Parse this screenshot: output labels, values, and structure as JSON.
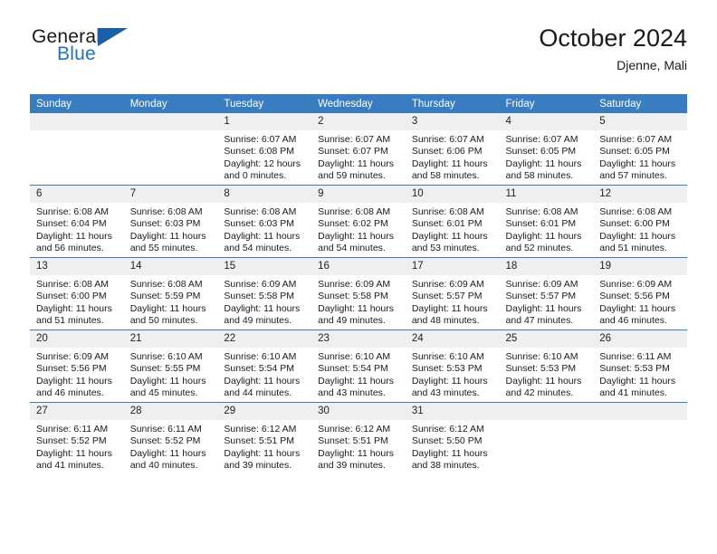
{
  "brand": {
    "name_part1": "General",
    "name_part2": "Blue",
    "mark": "triangle-logo"
  },
  "header": {
    "title": "October 2024",
    "location": "Djenne, Mali"
  },
  "weekday_headers": [
    "Sunday",
    "Monday",
    "Tuesday",
    "Wednesday",
    "Thursday",
    "Friday",
    "Saturday"
  ],
  "colors": {
    "header_blue": "#3a7cc0",
    "brand_blue": "#1b75bb",
    "daynum_band": "#efefef",
    "text": "#1a1a1a"
  },
  "weeks": [
    [
      {
        "day": "",
        "blank": true
      },
      {
        "day": "",
        "blank": true
      },
      {
        "day": "1",
        "sunrise": "Sunrise: 6:07 AM",
        "sunset": "Sunset: 6:08 PM",
        "daylight": "Daylight: 12 hours and 0 minutes."
      },
      {
        "day": "2",
        "sunrise": "Sunrise: 6:07 AM",
        "sunset": "Sunset: 6:07 PM",
        "daylight": "Daylight: 11 hours and 59 minutes."
      },
      {
        "day": "3",
        "sunrise": "Sunrise: 6:07 AM",
        "sunset": "Sunset: 6:06 PM",
        "daylight": "Daylight: 11 hours and 58 minutes."
      },
      {
        "day": "4",
        "sunrise": "Sunrise: 6:07 AM",
        "sunset": "Sunset: 6:05 PM",
        "daylight": "Daylight: 11 hours and 58 minutes."
      },
      {
        "day": "5",
        "sunrise": "Sunrise: 6:07 AM",
        "sunset": "Sunset: 6:05 PM",
        "daylight": "Daylight: 11 hours and 57 minutes."
      }
    ],
    [
      {
        "day": "6",
        "sunrise": "Sunrise: 6:08 AM",
        "sunset": "Sunset: 6:04 PM",
        "daylight": "Daylight: 11 hours and 56 minutes."
      },
      {
        "day": "7",
        "sunrise": "Sunrise: 6:08 AM",
        "sunset": "Sunset: 6:03 PM",
        "daylight": "Daylight: 11 hours and 55 minutes."
      },
      {
        "day": "8",
        "sunrise": "Sunrise: 6:08 AM",
        "sunset": "Sunset: 6:03 PM",
        "daylight": "Daylight: 11 hours and 54 minutes."
      },
      {
        "day": "9",
        "sunrise": "Sunrise: 6:08 AM",
        "sunset": "Sunset: 6:02 PM",
        "daylight": "Daylight: 11 hours and 54 minutes."
      },
      {
        "day": "10",
        "sunrise": "Sunrise: 6:08 AM",
        "sunset": "Sunset: 6:01 PM",
        "daylight": "Daylight: 11 hours and 53 minutes."
      },
      {
        "day": "11",
        "sunrise": "Sunrise: 6:08 AM",
        "sunset": "Sunset: 6:01 PM",
        "daylight": "Daylight: 11 hours and 52 minutes."
      },
      {
        "day": "12",
        "sunrise": "Sunrise: 6:08 AM",
        "sunset": "Sunset: 6:00 PM",
        "daylight": "Daylight: 11 hours and 51 minutes."
      }
    ],
    [
      {
        "day": "13",
        "sunrise": "Sunrise: 6:08 AM",
        "sunset": "Sunset: 6:00 PM",
        "daylight": "Daylight: 11 hours and 51 minutes."
      },
      {
        "day": "14",
        "sunrise": "Sunrise: 6:08 AM",
        "sunset": "Sunset: 5:59 PM",
        "daylight": "Daylight: 11 hours and 50 minutes."
      },
      {
        "day": "15",
        "sunrise": "Sunrise: 6:09 AM",
        "sunset": "Sunset: 5:58 PM",
        "daylight": "Daylight: 11 hours and 49 minutes."
      },
      {
        "day": "16",
        "sunrise": "Sunrise: 6:09 AM",
        "sunset": "Sunset: 5:58 PM",
        "daylight": "Daylight: 11 hours and 49 minutes."
      },
      {
        "day": "17",
        "sunrise": "Sunrise: 6:09 AM",
        "sunset": "Sunset: 5:57 PM",
        "daylight": "Daylight: 11 hours and 48 minutes."
      },
      {
        "day": "18",
        "sunrise": "Sunrise: 6:09 AM",
        "sunset": "Sunset: 5:57 PM",
        "daylight": "Daylight: 11 hours and 47 minutes."
      },
      {
        "day": "19",
        "sunrise": "Sunrise: 6:09 AM",
        "sunset": "Sunset: 5:56 PM",
        "daylight": "Daylight: 11 hours and 46 minutes."
      }
    ],
    [
      {
        "day": "20",
        "sunrise": "Sunrise: 6:09 AM",
        "sunset": "Sunset: 5:56 PM",
        "daylight": "Daylight: 11 hours and 46 minutes."
      },
      {
        "day": "21",
        "sunrise": "Sunrise: 6:10 AM",
        "sunset": "Sunset: 5:55 PM",
        "daylight": "Daylight: 11 hours and 45 minutes."
      },
      {
        "day": "22",
        "sunrise": "Sunrise: 6:10 AM",
        "sunset": "Sunset: 5:54 PM",
        "daylight": "Daylight: 11 hours and 44 minutes."
      },
      {
        "day": "23",
        "sunrise": "Sunrise: 6:10 AM",
        "sunset": "Sunset: 5:54 PM",
        "daylight": "Daylight: 11 hours and 43 minutes."
      },
      {
        "day": "24",
        "sunrise": "Sunrise: 6:10 AM",
        "sunset": "Sunset: 5:53 PM",
        "daylight": "Daylight: 11 hours and 43 minutes."
      },
      {
        "day": "25",
        "sunrise": "Sunrise: 6:10 AM",
        "sunset": "Sunset: 5:53 PM",
        "daylight": "Daylight: 11 hours and 42 minutes."
      },
      {
        "day": "26",
        "sunrise": "Sunrise: 6:11 AM",
        "sunset": "Sunset: 5:53 PM",
        "daylight": "Daylight: 11 hours and 41 minutes."
      }
    ],
    [
      {
        "day": "27",
        "sunrise": "Sunrise: 6:11 AM",
        "sunset": "Sunset: 5:52 PM",
        "daylight": "Daylight: 11 hours and 41 minutes."
      },
      {
        "day": "28",
        "sunrise": "Sunrise: 6:11 AM",
        "sunset": "Sunset: 5:52 PM",
        "daylight": "Daylight: 11 hours and 40 minutes."
      },
      {
        "day": "29",
        "sunrise": "Sunrise: 6:12 AM",
        "sunset": "Sunset: 5:51 PM",
        "daylight": "Daylight: 11 hours and 39 minutes."
      },
      {
        "day": "30",
        "sunrise": "Sunrise: 6:12 AM",
        "sunset": "Sunset: 5:51 PM",
        "daylight": "Daylight: 11 hours and 39 minutes."
      },
      {
        "day": "31",
        "sunrise": "Sunrise: 6:12 AM",
        "sunset": "Sunset: 5:50 PM",
        "daylight": "Daylight: 11 hours and 38 minutes."
      },
      {
        "day": "",
        "blank": true
      },
      {
        "day": "",
        "blank": true
      }
    ]
  ]
}
